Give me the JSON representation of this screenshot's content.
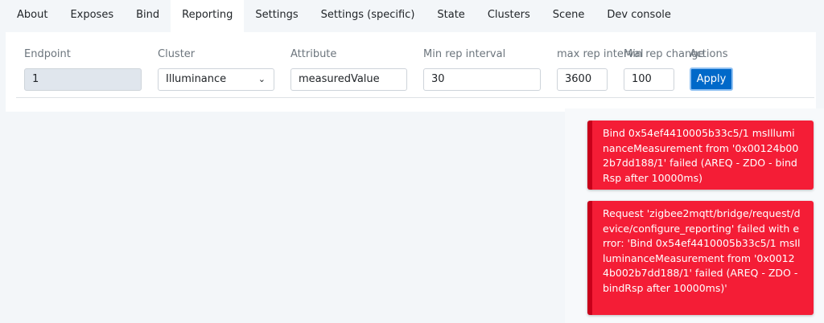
{
  "tabs": [
    "About",
    "Exposes",
    "Bind",
    "Reporting",
    "Settings",
    "Settings (specific)",
    "State",
    "Clusters",
    "Scene",
    "Dev console"
  ],
  "active_tab": "Reporting",
  "form": {
    "endpoint": {
      "label": "Endpoint",
      "value": "1"
    },
    "cluster": {
      "label": "Cluster",
      "value": "Illuminance"
    },
    "attribute": {
      "label": "Attribute",
      "value": "measuredValue"
    },
    "min_rep_interval": {
      "label": "Min rep interval",
      "value": "30"
    },
    "max_rep_interval": {
      "label": "max rep interval",
      "value": "3600"
    },
    "min_rep_change": {
      "label": "Min rep change",
      "value": "100"
    },
    "actions": {
      "label": "Actions",
      "apply": "Apply"
    }
  },
  "toasts": [
    "Bind 0x54ef4410005b33c5/1 msIlluminanceMeasurement from '0x00124b002b7dd188/1' failed (AREQ - ZDO - bindRsp after 10000ms)",
    "Request 'zigbee2mqtt/bridge/request/device/configure_reporting' failed with error: 'Bind 0x54ef4410005b33c5/1 msIlluminanceMeasurement from '0x00124b002b7dd188/1' failed (AREQ - ZDO - bindRsp after 10000ms)'"
  ],
  "colors": {
    "accent": "#0069c9",
    "error": "#f41d36"
  }
}
